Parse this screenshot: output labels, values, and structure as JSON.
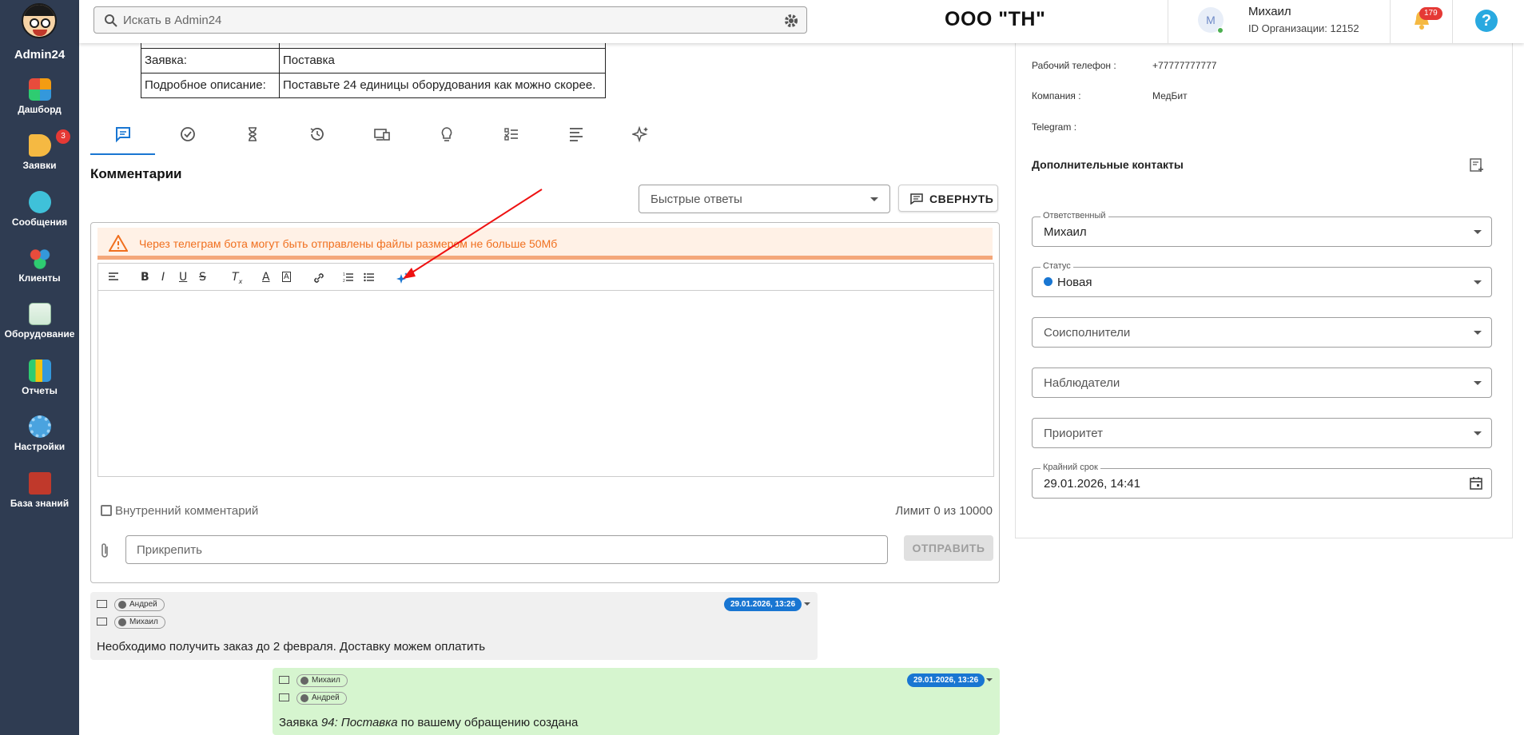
{
  "app": {
    "name": "Admin24"
  },
  "sidebar": {
    "items": [
      {
        "label": "Дашборд",
        "badge": ""
      },
      {
        "label": "Заявки",
        "badge": "3"
      },
      {
        "label": "Сообщения",
        "badge": ""
      },
      {
        "label": "Клиенты",
        "badge": ""
      },
      {
        "label": "Оборудование",
        "badge": ""
      },
      {
        "label": "Отчеты",
        "badge": ""
      },
      {
        "label": "Настройки",
        "badge": ""
      },
      {
        "label": "База знаний",
        "badge": ""
      }
    ]
  },
  "topbar": {
    "search_placeholder": "Искать в Admin24",
    "org_title": "ООО \"ТН\"",
    "avatar_letter": "M",
    "user_name": "Михаил",
    "org_id": "ID Организации: 12152",
    "notifications": "179"
  },
  "request_table": {
    "rows": [
      {
        "key": "Заявка:",
        "value": "Поставка"
      },
      {
        "key": "Подробное описание:",
        "value": "Поставьте 24 единицы оборудования как можно скорее."
      }
    ]
  },
  "tabs": [
    "comments",
    "check",
    "hourglass",
    "history",
    "devices",
    "lightbulb",
    "checklist",
    "text",
    "ai"
  ],
  "comments": {
    "title": "Комментарии",
    "quick_replies": "Быстрые ответы",
    "collapse_label": "СВЕРНУТЬ",
    "warning": "Через телеграм бота могут быть отправлены файлы размером не больше 50Мб",
    "internal_label": "Внутренний комментарий",
    "limit": "Лимит 0 из 10000",
    "attach_placeholder": "Прикрепить",
    "send_label": "ОТПРАВИТЬ"
  },
  "messages": [
    {
      "from": "Андрей",
      "to": "Михаил",
      "date": "29.01.2026, 13:26",
      "text": "Необходимо получить заказ до 2 февраля. Доставку можем оплатить"
    },
    {
      "from": "Михаил",
      "to": "Андрей",
      "date": "29.01.2026, 13:26",
      "text_prefix": "Заявка ",
      "text_italic": "94: Поставка",
      "text_suffix": " по вашему обращению создана"
    }
  ],
  "details": {
    "work_phone_label": "Рабочий телефон :",
    "work_phone": "+77777777777",
    "company_label": "Компания :",
    "company": "МедБит",
    "telegram_label": "Telegram :",
    "extra_contacts": "Дополнительные контакты",
    "responsible_label": "Ответственный",
    "responsible": "Михаил",
    "status_label": "Статус",
    "status": "Новая",
    "coexecutors": "Соисполнители",
    "observers": "Наблюдатели",
    "priority": "Приоритет",
    "deadline_label": "Крайний срок",
    "deadline": "29.01.2026, 14:41"
  },
  "colors": {
    "sidebar": "#2f3c52",
    "accent": "#1976d2",
    "warning_text": "#f06f1e",
    "status_dot": "#1976d2"
  }
}
